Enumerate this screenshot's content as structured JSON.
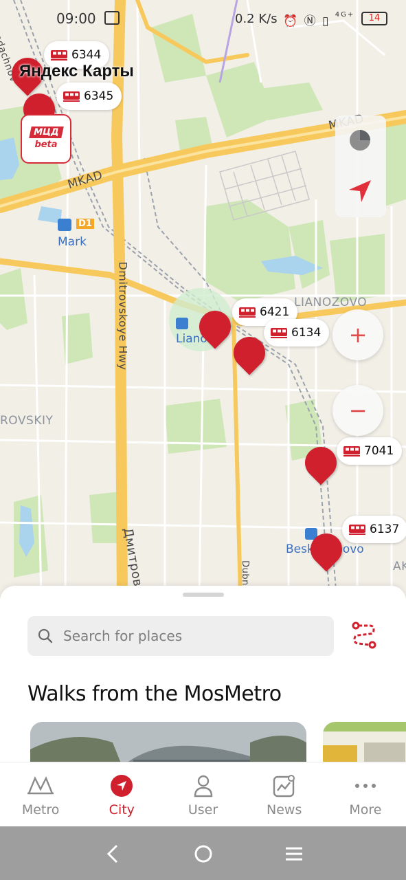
{
  "status_bar": {
    "time": "09:00",
    "speed": "0.2 K/s",
    "network": "4G+",
    "battery": "14"
  },
  "map": {
    "logo": "Яндекс Карты",
    "mcd_badge": {
      "top": "МЦД",
      "bottom": "beta"
    },
    "road_labels": {
      "mkad_left": "MKAD",
      "mkad_right": "MKAD",
      "dmitrovskoye": "Dmitrovskoye Hwy",
      "dmitrov_ru": "Дмитров",
      "dubni": "Dubni",
      "lianozovo": "LIANOZOVO",
      "rovskiy": "ROVSKIY",
      "vodachnov": "vodachnov",
      "ak": "AK"
    },
    "stations": {
      "mark": "Mark",
      "mark_line": "D1",
      "lianozovo_station": "Liano",
      "beskudnikovo_a": "Besk",
      "beskudnikovo_b": "ovo"
    },
    "trains": [
      {
        "number": "6344"
      },
      {
        "number": "6345"
      },
      {
        "number": "6421"
      },
      {
        "number": "6134"
      },
      {
        "number": "7041"
      },
      {
        "number": "6137"
      }
    ],
    "controls": {
      "zoom_in": "+",
      "zoom_out": "−"
    },
    "colors": {
      "accent": "#d0202e",
      "road_major": "#f7c95c",
      "park": "#c9e3b0",
      "water": "#a9d4ee"
    }
  },
  "sheet": {
    "search_placeholder": "Search for places",
    "section_title": "Walks from the MosMetro"
  },
  "tabbar": {
    "tabs": [
      {
        "label": "Metro",
        "icon": "metro-icon",
        "active": false
      },
      {
        "label": "City",
        "icon": "navigation-arrow-icon",
        "active": true
      },
      {
        "label": "User",
        "icon": "user-icon",
        "active": false
      },
      {
        "label": "News",
        "icon": "news-icon",
        "active": false
      },
      {
        "label": "More",
        "icon": "more-icon",
        "active": false
      }
    ]
  }
}
